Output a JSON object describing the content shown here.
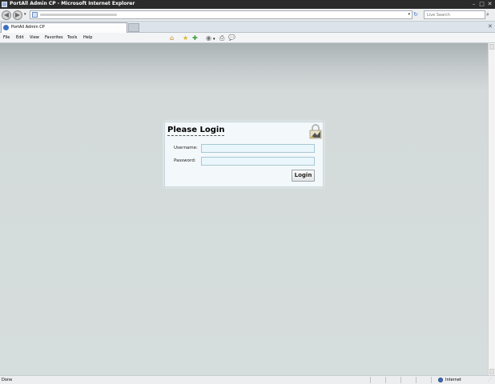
{
  "window": {
    "title": "PortAll Admin CP - Microsoft Internet Explorer",
    "minimize_glyph": "–",
    "maximize_glyph": "□",
    "close_glyph": "✕"
  },
  "toolbar": {
    "back_glyph": "◀",
    "forward_glyph": "▶",
    "dropdown_glyph": "▾",
    "refresh_glyph": "↻",
    "stop_glyph": "✕",
    "search_placeholder": "Live Search",
    "search_glyph": "⌕"
  },
  "tabs": {
    "active_label": "PortAll Admin CP",
    "close_glyph": "✕"
  },
  "menu": {
    "items": [
      "File",
      "Edit",
      "View",
      "Favorites",
      "Tools",
      "Help"
    ]
  },
  "command_bar": {
    "home_glyph": "⌂",
    "favorites_glyph": "★",
    "add_favorite_glyph": "✚",
    "feeds_glyph": "◉",
    "feeds_dd_glyph": "▾",
    "print_glyph": "⎙",
    "research_glyph": "💬"
  },
  "login": {
    "title": "Please Login",
    "username_label": "Username:",
    "password_label": "Password:",
    "username_value": "",
    "password_value": "",
    "button_label": "Login"
  },
  "status": {
    "text": "Done",
    "zone": "Internet",
    "grip_glyph": "⋰"
  }
}
